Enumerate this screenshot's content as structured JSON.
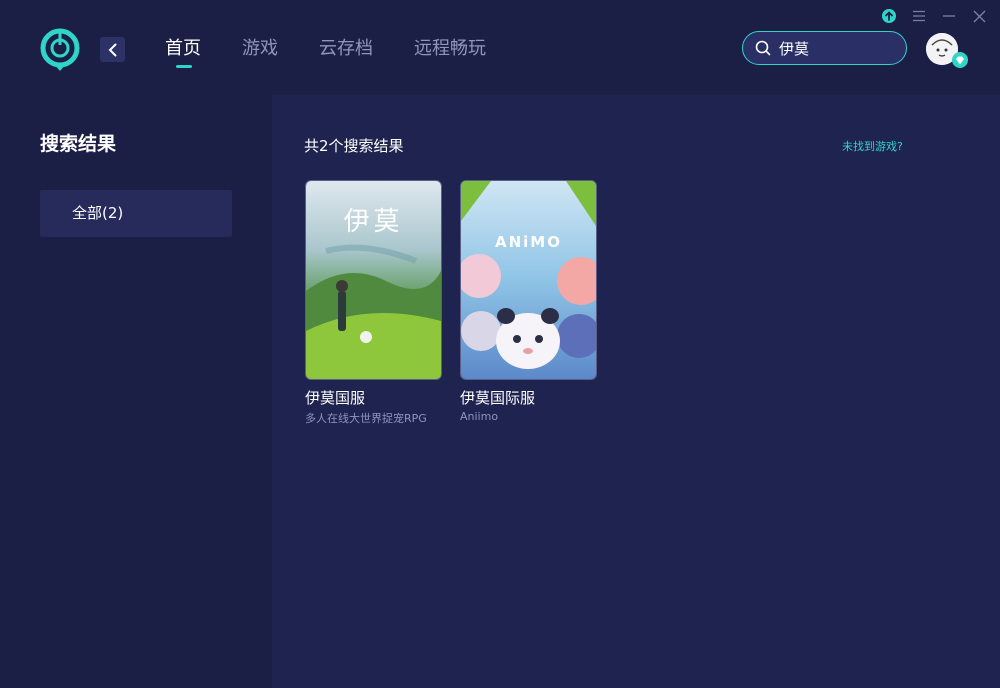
{
  "app": {
    "nav": [
      {
        "label": "首页",
        "active": true
      },
      {
        "label": "游戏",
        "active": false
      },
      {
        "label": "云存档",
        "active": false
      },
      {
        "label": "远程畅玩",
        "active": false
      }
    ],
    "search": {
      "value": "伊莫"
    },
    "accent_color": "#2fd5c9"
  },
  "sidebar": {
    "title": "搜索结果",
    "filters": [
      {
        "label": "全部(2)",
        "selected": true
      }
    ]
  },
  "main": {
    "result_count": "共2个搜索结果",
    "not_found_link": "未找到游戏?",
    "games": [
      {
        "name": "伊莫国服",
        "desc": "多人在线大世界捉宠RPG",
        "cover_text": "伊莫"
      },
      {
        "name": "伊莫国际服",
        "desc": "Aniimo",
        "cover_text": "ANiMO"
      }
    ]
  }
}
